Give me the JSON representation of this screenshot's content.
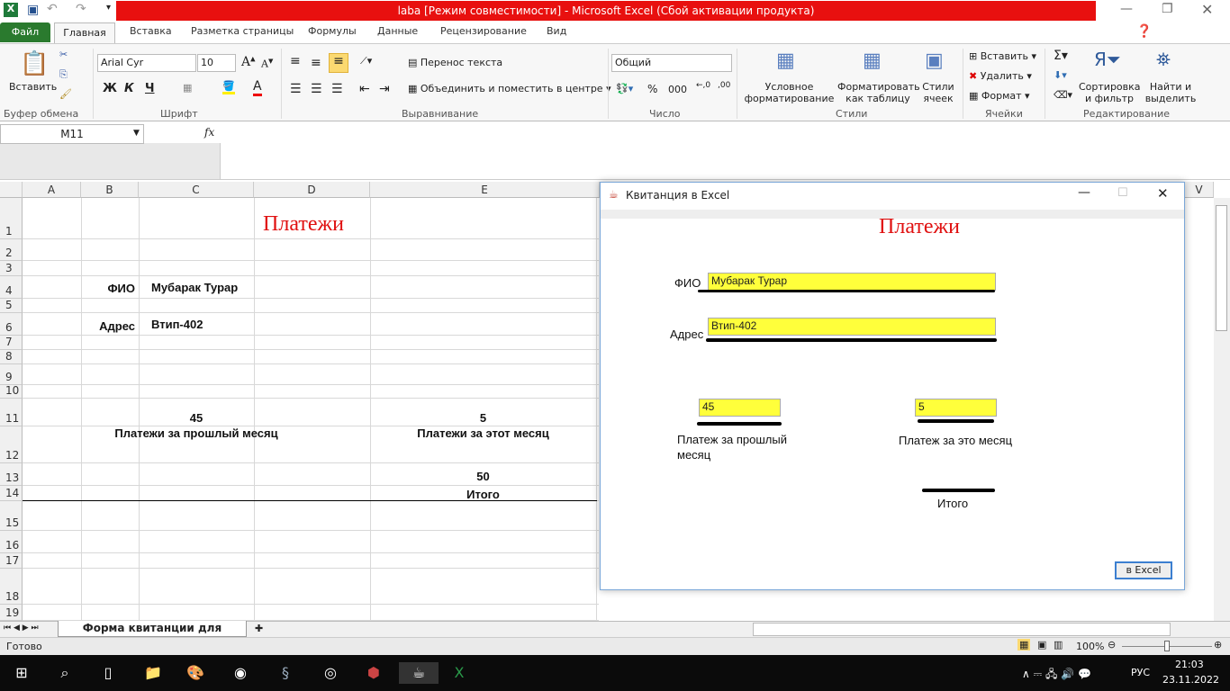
{
  "window": {
    "title": "laba  [Режим совместимости]  -  Microsoft Excel (Сбой активации продукта)"
  },
  "ribbon_tabs": [
    "Файл",
    "Главная",
    "Вставка",
    "Разметка страницы",
    "Формулы",
    "Данные",
    "Рецензирование",
    "Вид"
  ],
  "ribbon": {
    "clipboard": {
      "paste": "Вставить",
      "group": "Буфер обмена"
    },
    "font": {
      "name": "Arial Cyr",
      "size": "10",
      "bold": "Ж",
      "italic": "К",
      "underline": "Ч",
      "group": "Шрифт"
    },
    "alignment": {
      "wrap": "Перенос текста",
      "merge": "Объединить и поместить в центре",
      "group": "Выравнивание"
    },
    "number": {
      "format": "Общий",
      "percent": "%",
      "thousands": "000",
      "group": "Число"
    },
    "styles": {
      "conditional": "Условное форматирование",
      "as_table": "Форматировать как таблицу",
      "cell_styles": "Стили ячеек",
      "group": "Стили"
    },
    "cells": {
      "insert": "Вставить",
      "delete": "Удалить",
      "format": "Формат",
      "group": "Ячейки"
    },
    "editing": {
      "sort": "Сортировка и фильтр",
      "find": "Найти и выделить",
      "group": "Редактирование"
    }
  },
  "formula_bar": {
    "name_box": "M11",
    "fx": "fx",
    "value": ""
  },
  "columns": [
    "A",
    "B",
    "C",
    "D",
    "E"
  ],
  "right_column": "V",
  "rows": [
    "1",
    "2",
    "3",
    "4",
    "5",
    "6",
    "7",
    "8",
    "9",
    "10",
    "11",
    "12",
    "13",
    "14",
    "15",
    "16",
    "17",
    "18",
    "19"
  ],
  "sheet": {
    "title": "Платежи",
    "fio_label": "ФИО",
    "fio": "Мубарак Турар",
    "address_label": "Адрес",
    "address": "Втип-402",
    "prev_value": "45",
    "prev_label": "Платежи за прошлый месяц",
    "cur_value": "5",
    "cur_label": "Платежи за этот месяц",
    "total_value": "50",
    "total_label": "Итого"
  },
  "sheet_tab": "Форма квитанции для оплаты",
  "status": {
    "text": "Готово",
    "zoom": "100%"
  },
  "dialog": {
    "title": "Квитанция в Excel",
    "heading": "Платежи",
    "fio_label": "ФИО",
    "fio": "Мубарак Турар",
    "address_label": "Адрес",
    "address": "Втип-402",
    "prev_value": "45",
    "prev_label": "Платеж за прошлый месяц",
    "cur_value": "5",
    "cur_label": "Платеж за это месяц",
    "total_label": "Итого",
    "button": "в Excel"
  },
  "taskbar": {
    "lang": "РУС",
    "time": "21:03",
    "date": "23.11.2022"
  },
  "colors": {
    "title_red": "#e8100f",
    "file_green": "#2a7a2e",
    "field_yellow": "#ffff3b",
    "heading_red": "#e01010"
  }
}
